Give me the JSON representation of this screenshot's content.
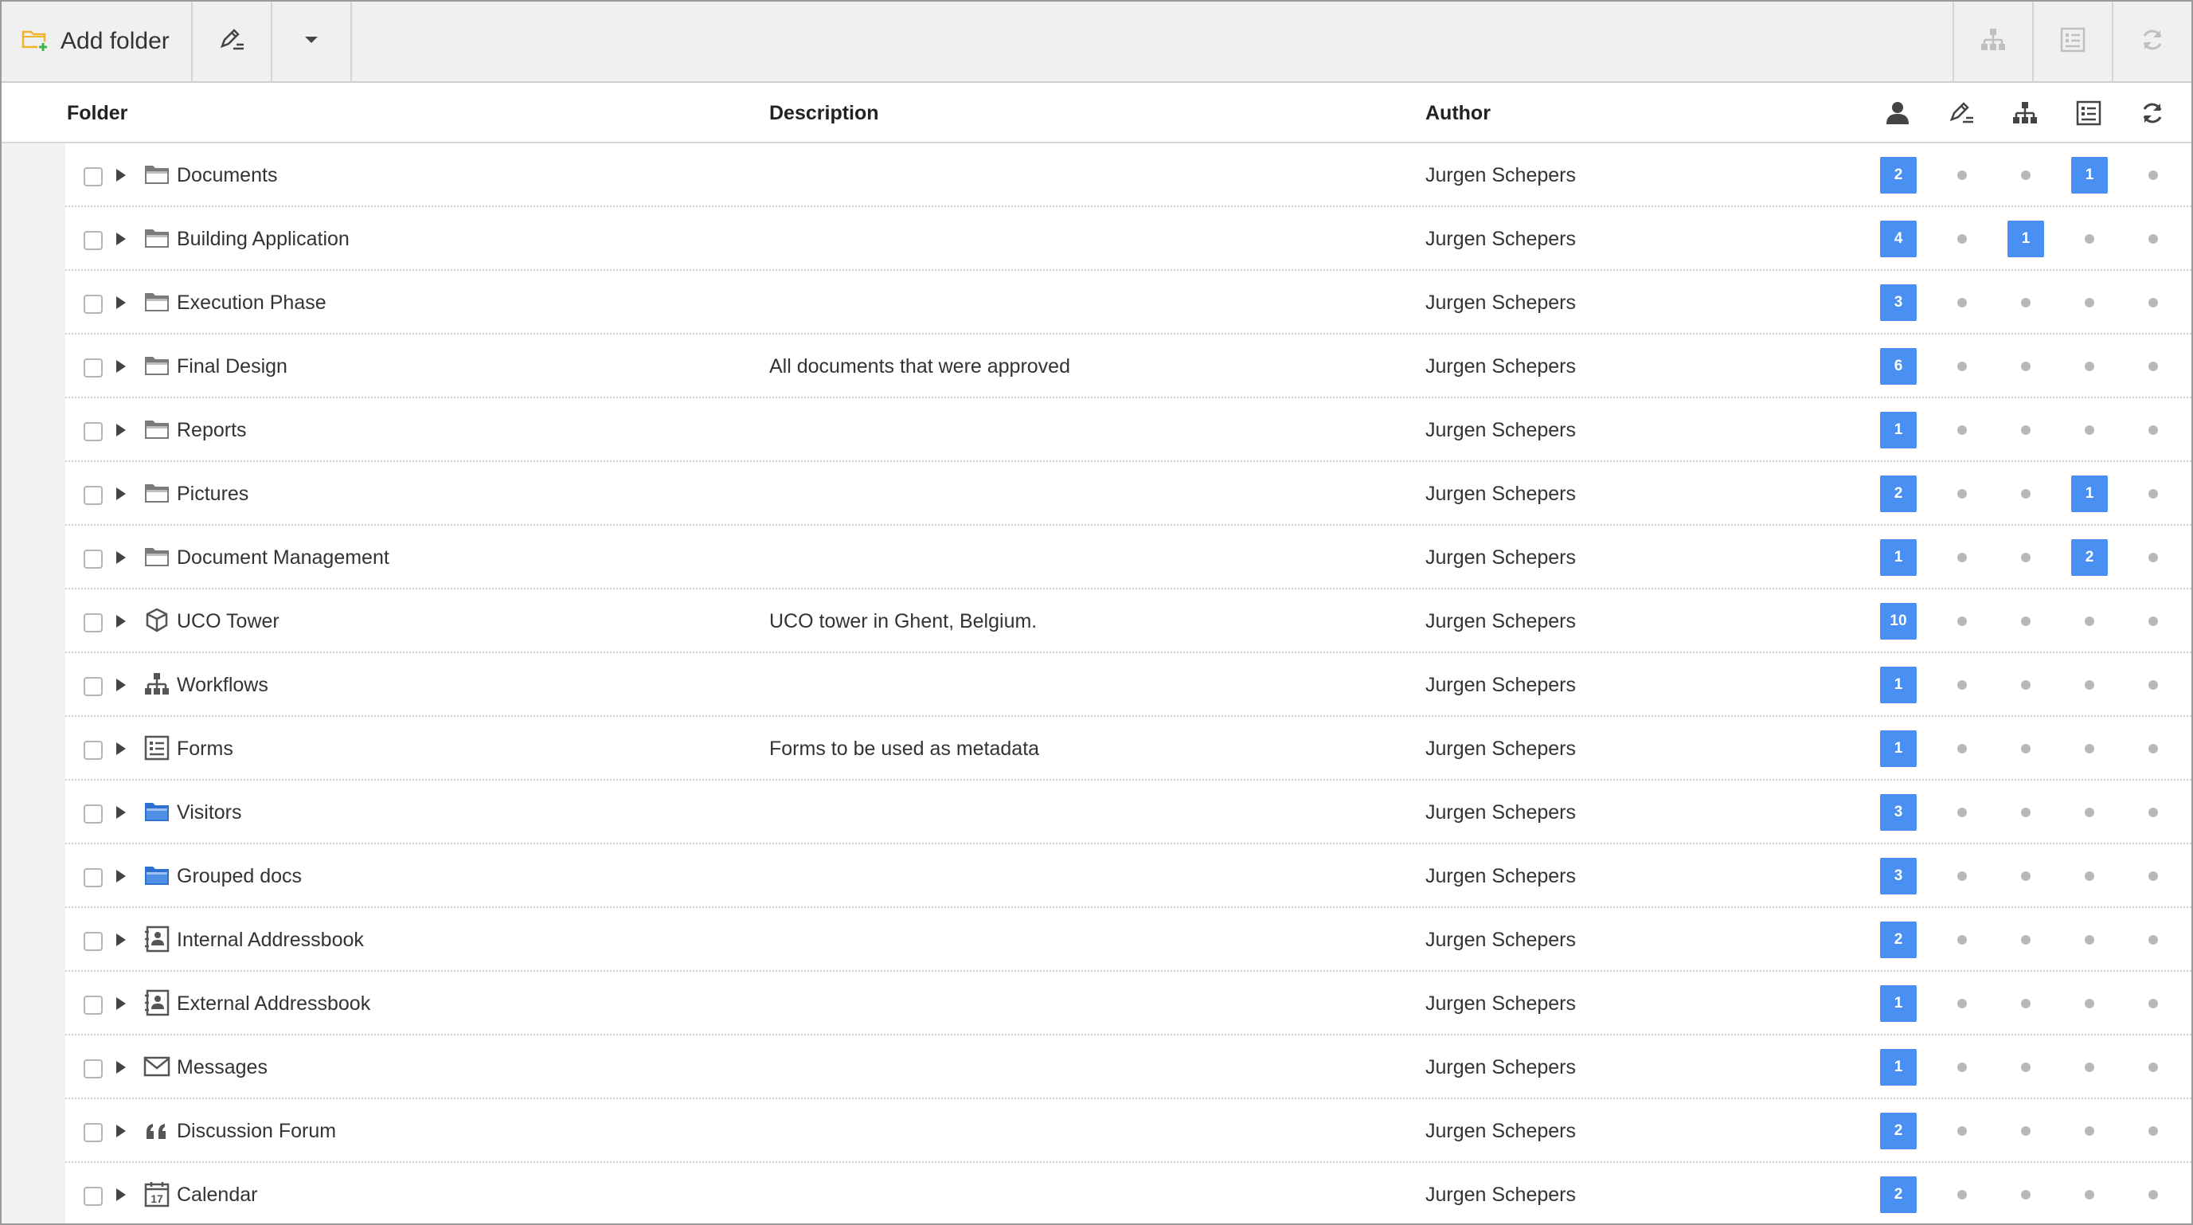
{
  "toolbar": {
    "add_folder_label": "Add folder",
    "add_folder_icon": "folder-plus-icon",
    "edit_icon": "edit-pen-icon",
    "dropdown_icon": "caret-down-icon",
    "right_icons": [
      "workflow-icon",
      "form-icon",
      "sync-icon"
    ]
  },
  "columns": {
    "folder": "Folder",
    "description": "Description",
    "author": "Author",
    "status_icons": [
      "user-icon",
      "edit-pen-icon",
      "workflow-icon",
      "form-icon",
      "sync-icon"
    ]
  },
  "colors": {
    "badge": "#4a90f2",
    "dot": "#b7b7b7",
    "folder_gray": "#777777",
    "folder_blue": "#3a78d8"
  },
  "rows": [
    {
      "name": "Documents",
      "icon": "folder-icon",
      "description": "",
      "author": "Jurgen Schepers",
      "counts": [
        "2",
        "",
        "",
        "1",
        ""
      ]
    },
    {
      "name": "Building Application",
      "icon": "folder-icon",
      "description": "",
      "author": "Jurgen Schepers",
      "counts": [
        "4",
        "",
        "1",
        "",
        ""
      ]
    },
    {
      "name": "Execution Phase",
      "icon": "folder-icon",
      "description": "",
      "author": "Jurgen Schepers",
      "counts": [
        "3",
        "",
        "",
        "",
        ""
      ]
    },
    {
      "name": "Final Design",
      "icon": "folder-icon",
      "description": "All documents that were approved",
      "author": "Jurgen Schepers",
      "counts": [
        "6",
        "",
        "",
        "",
        ""
      ]
    },
    {
      "name": "Reports",
      "icon": "folder-icon",
      "description": "",
      "author": "Jurgen Schepers",
      "counts": [
        "1",
        "",
        "",
        "",
        ""
      ]
    },
    {
      "name": "Pictures",
      "icon": "folder-icon",
      "description": "",
      "author": "Jurgen Schepers",
      "counts": [
        "2",
        "",
        "",
        "1",
        ""
      ]
    },
    {
      "name": "Document Management",
      "icon": "folder-icon",
      "description": "",
      "author": "Jurgen Schepers",
      "counts": [
        "1",
        "",
        "",
        "2",
        ""
      ]
    },
    {
      "name": "UCO Tower",
      "icon": "cube-icon",
      "description": "UCO tower in Ghent, Belgium.",
      "author": "Jurgen Schepers",
      "counts": [
        "10",
        "",
        "",
        "",
        ""
      ]
    },
    {
      "name": "Workflows",
      "icon": "workflow-icon",
      "description": "",
      "author": "Jurgen Schepers",
      "counts": [
        "1",
        "",
        "",
        "",
        ""
      ]
    },
    {
      "name": "Forms",
      "icon": "form-icon",
      "description": "Forms to be used as metadata",
      "author": "Jurgen Schepers",
      "counts": [
        "1",
        "",
        "",
        "",
        ""
      ]
    },
    {
      "name": "Visitors",
      "icon": "folder-blue-icon",
      "description": "",
      "author": "Jurgen Schepers",
      "counts": [
        "3",
        "",
        "",
        "",
        ""
      ]
    },
    {
      "name": "Grouped docs",
      "icon": "folder-blue-icon",
      "description": "",
      "author": "Jurgen Schepers",
      "counts": [
        "3",
        "",
        "",
        "",
        ""
      ]
    },
    {
      "name": "Internal Addressbook",
      "icon": "addressbook-icon",
      "description": "",
      "author": "Jurgen Schepers",
      "counts": [
        "2",
        "",
        "",
        "",
        ""
      ]
    },
    {
      "name": "External Addressbook",
      "icon": "addressbook-icon",
      "description": "",
      "author": "Jurgen Schepers",
      "counts": [
        "1",
        "",
        "",
        "",
        ""
      ]
    },
    {
      "name": "Messages",
      "icon": "envelope-icon",
      "description": "",
      "author": "Jurgen Schepers",
      "counts": [
        "1",
        "",
        "",
        "",
        ""
      ]
    },
    {
      "name": "Discussion Forum",
      "icon": "quote-icon",
      "description": "",
      "author": "Jurgen Schepers",
      "counts": [
        "2",
        "",
        "",
        "",
        ""
      ]
    },
    {
      "name": "Calendar",
      "icon": "calendar-icon",
      "description": "",
      "author": "Jurgen Schepers",
      "counts": [
        "2",
        "",
        "",
        "",
        ""
      ]
    }
  ]
}
